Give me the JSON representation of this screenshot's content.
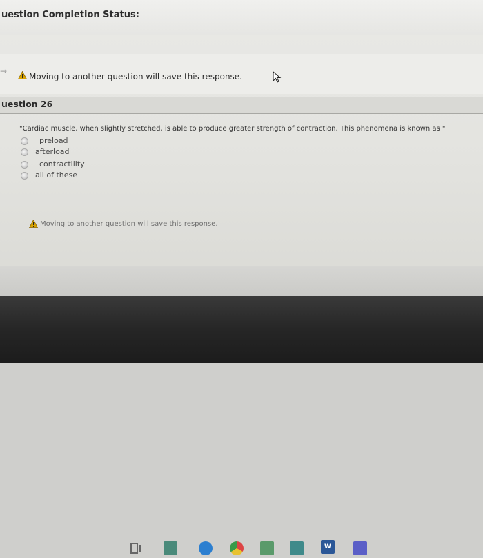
{
  "header": {
    "title": "uestion Completion Status:"
  },
  "banner": {
    "arrow": "→",
    "message": "Moving to another question will save this response."
  },
  "question": {
    "title": "uestion 26",
    "text": "\"Cardiac muscle, when slightly stretched, is able to produce greater strength of contraction. This phenomena is known as \"",
    "options": [
      {
        "label": "preload"
      },
      {
        "label": "afterload"
      },
      {
        "label": "contractility"
      },
      {
        "label": "all of these"
      }
    ]
  },
  "footer": {
    "message": "Moving to another question will save this response."
  },
  "taskbar": {
    "icons": [
      "task-view-icon",
      "file-explorer-icon",
      "edge-icon",
      "chrome-icon",
      "calculator-icon",
      "mail-icon",
      "word-icon",
      "teams-icon"
    ],
    "word_letter": "W"
  },
  "colors": {
    "warning": "#d9a400",
    "word": "#2b5797",
    "teams": "#5b5fc7",
    "edge": "#2c7fd0"
  }
}
